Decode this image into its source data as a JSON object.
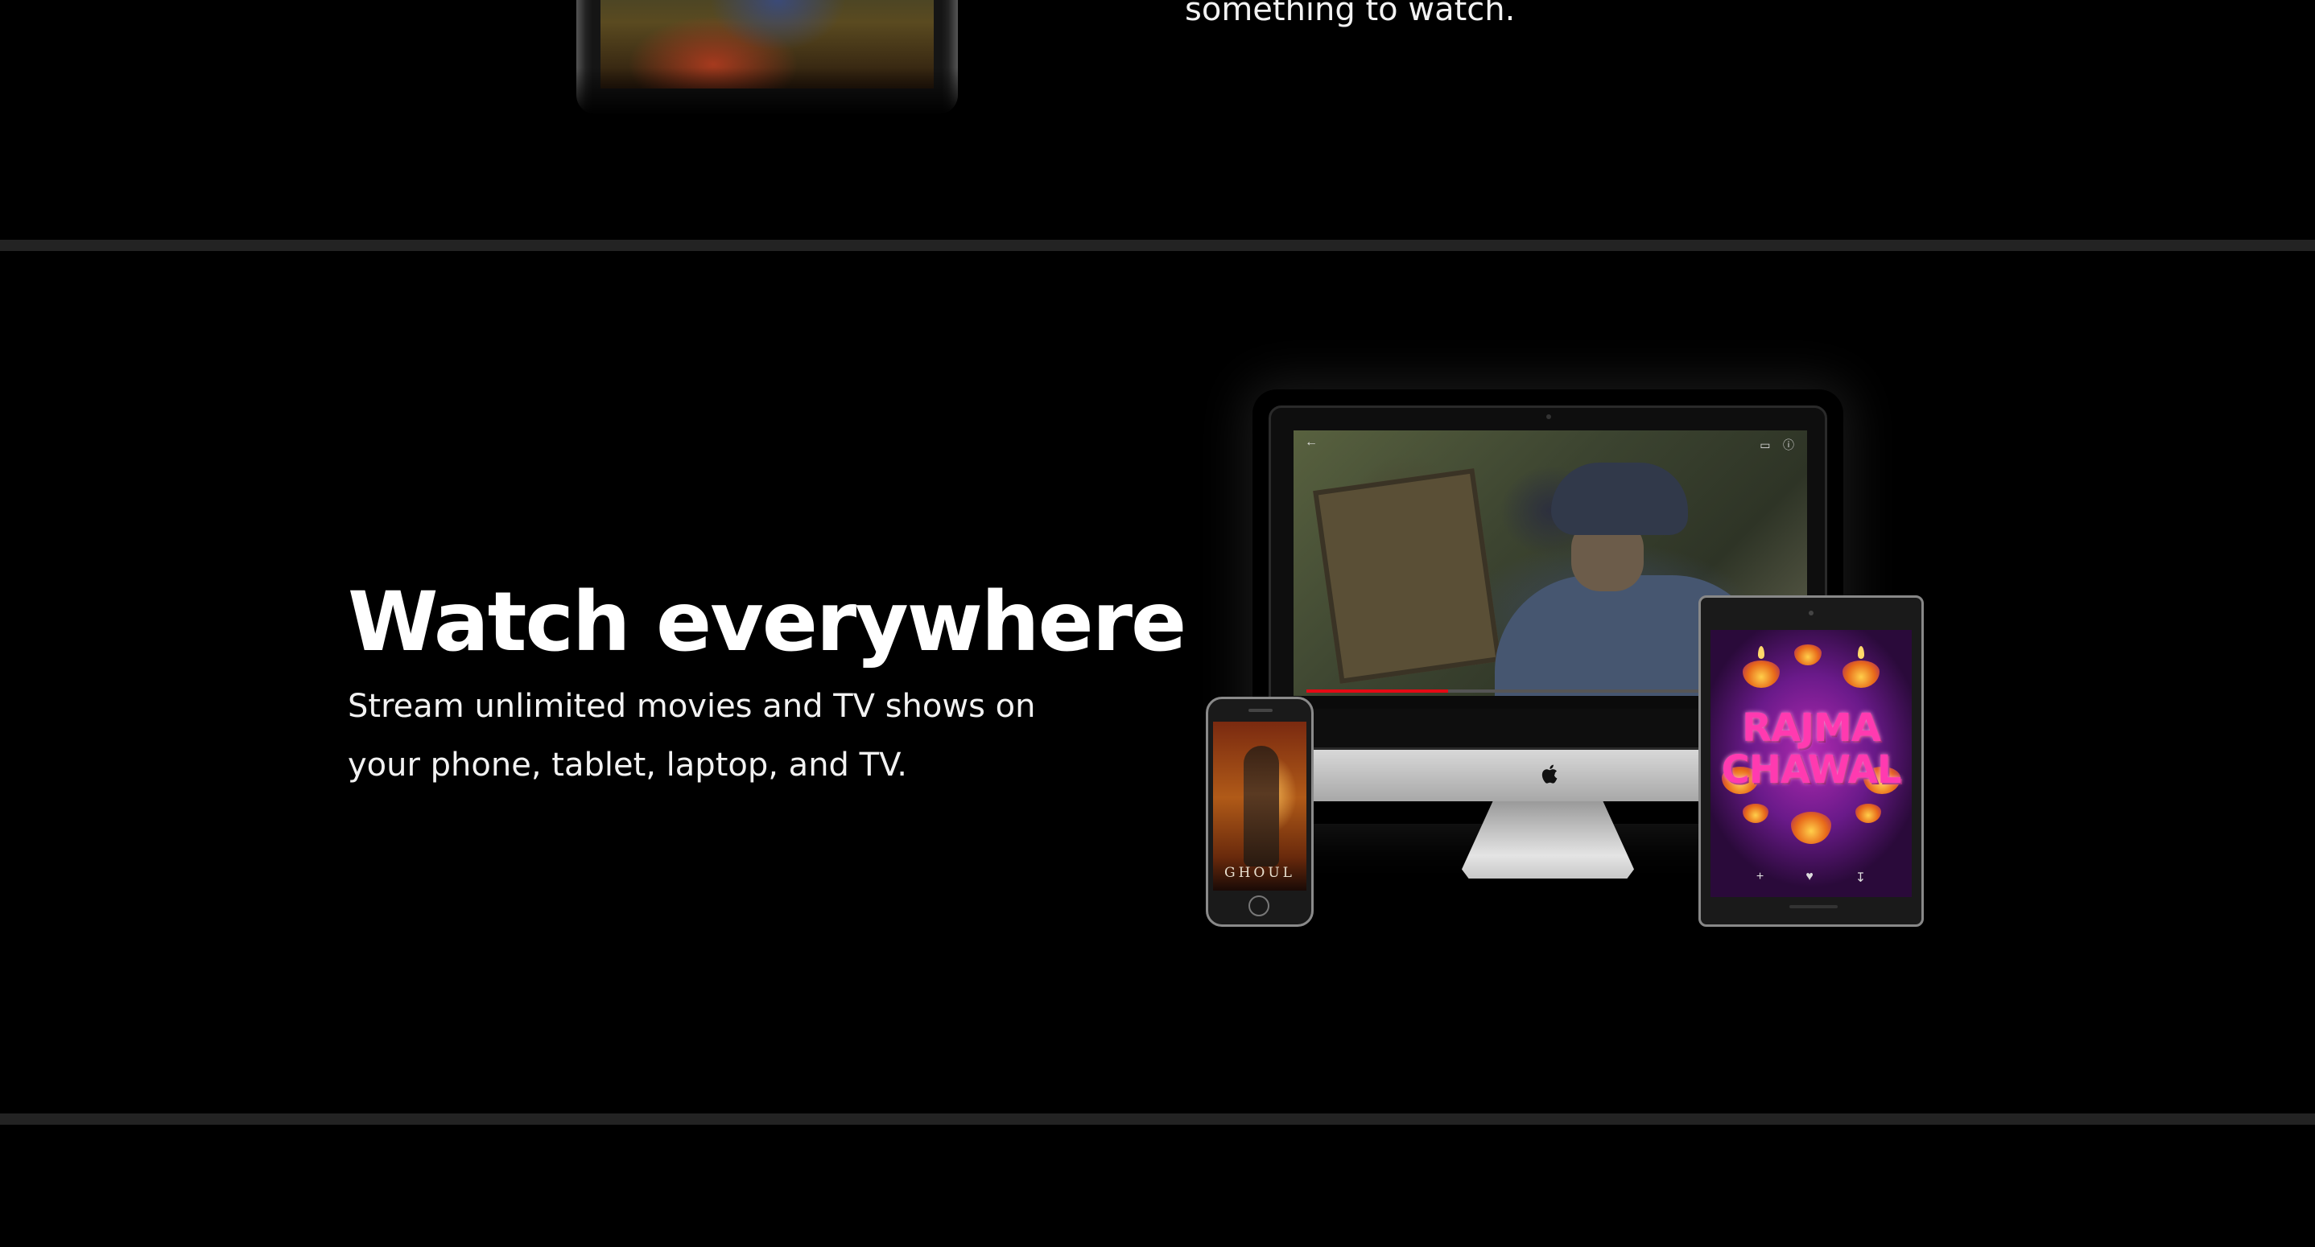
{
  "top_section": {
    "text_fragment": "something to watch."
  },
  "watch_section": {
    "title": "Watch everywhere",
    "subtitle": "Stream unlimited movies and TV shows on your phone, tablet, laptop, and TV."
  },
  "devices": {
    "phone_poster_title": "GHOUL",
    "tablet_poster_title_line1": "RAJMA",
    "tablet_poster_title_line2": "CHAWAL",
    "playback_progress": 0.29,
    "icons": {
      "back": "arrow-left-icon",
      "cast": "cast-icon",
      "help": "help-icon",
      "apple_logo": "apple-logo-icon",
      "add": "plus-icon",
      "like": "thumbs-up-icon",
      "download": "download-icon"
    }
  },
  "colors": {
    "background": "#000000",
    "divider": "#232323",
    "accent_red": "#e50914",
    "text": "#ffffff"
  }
}
